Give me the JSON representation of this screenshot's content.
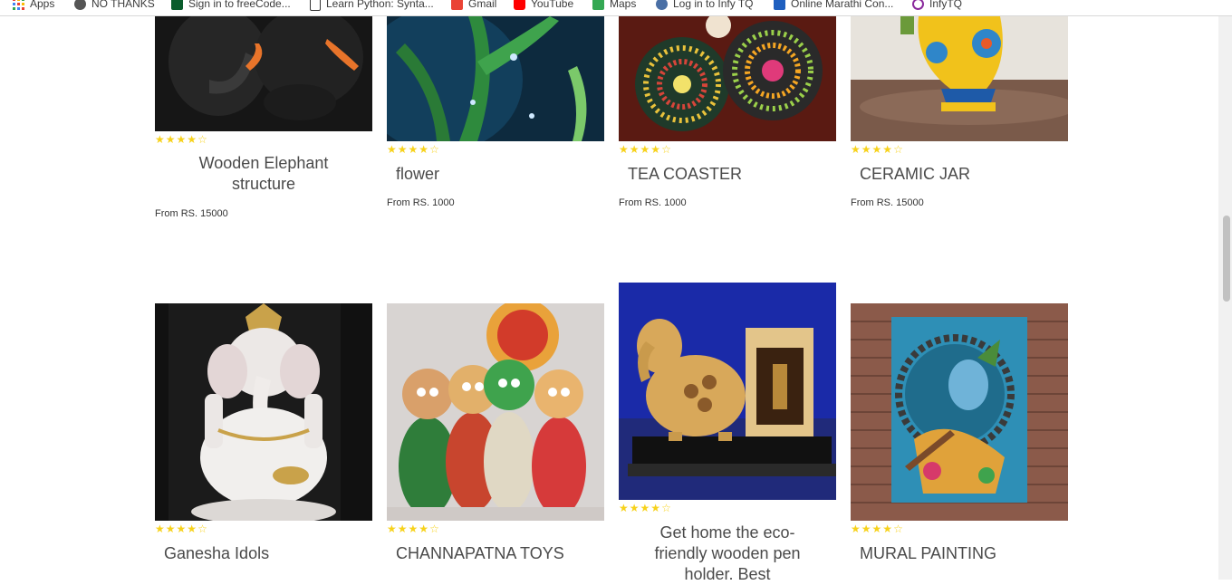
{
  "bookmarks": [
    {
      "label": "Apps",
      "icon": "apps-grid-icon"
    },
    {
      "label": "NO THANKS",
      "icon": "globe-icon"
    },
    {
      "label": "Sign in to freeCode...",
      "icon": "freecodecamp-icon"
    },
    {
      "label": "Learn Python: Synta...",
      "icon": "document-icon"
    },
    {
      "label": "Gmail",
      "icon": "gmail-icon"
    },
    {
      "label": "YouTube",
      "icon": "youtube-icon"
    },
    {
      "label": "Maps",
      "icon": "maps-icon"
    },
    {
      "label": "Log in to Infy TQ",
      "icon": "infytq-icon"
    },
    {
      "label": "Online Marathi Con...",
      "icon": "marathi-icon"
    },
    {
      "label": "InfyTQ",
      "icon": "infytq-logo-icon"
    }
  ],
  "rating": {
    "filled": "★",
    "empty": "☆",
    "score": 4,
    "max": 5
  },
  "products": [
    {
      "title": "Wooden Elephant structure",
      "price": "From RS. 15000",
      "image": "wooden-elephant-image"
    },
    {
      "title": "flower",
      "price": "From RS. 1000",
      "image": "flower-image"
    },
    {
      "title": "TEA COASTER",
      "price": "From RS. 1000",
      "image": "tea-coaster-image"
    },
    {
      "title": "CERAMIC JAR",
      "price": "From RS. 15000",
      "image": "ceramic-jar-image"
    },
    {
      "title": "Ganesha Idols",
      "price": "",
      "image": "ganesha-idol-image"
    },
    {
      "title": "CHANNAPATNA TOYS",
      "price": "",
      "image": "channapatna-toys-image"
    },
    {
      "title": "Get home the eco-friendly wooden pen holder. Best",
      "price": "",
      "image": "pen-holder-image"
    },
    {
      "title": "MURAL PAINTING",
      "price": "",
      "image": "mural-painting-image"
    }
  ]
}
